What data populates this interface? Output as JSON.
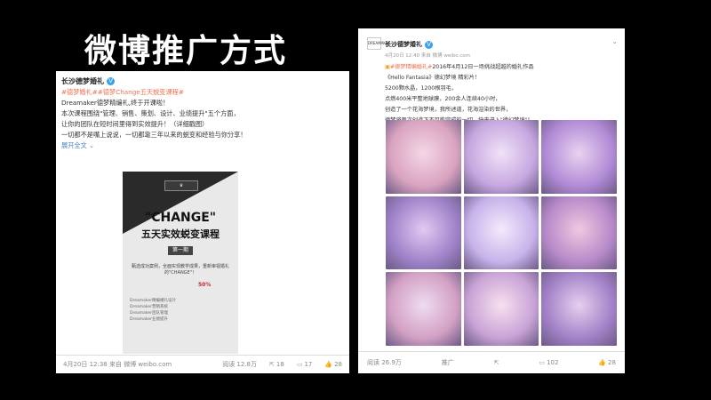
{
  "slide": {
    "title": "微博推广方式"
  },
  "post1": {
    "username": "长沙德梦婚礼",
    "tags_line": "#德梦婚礼##德梦Change五天蜕变课程#",
    "line2": "Dreamaker德梦精编礼,终于开课啦！",
    "body": [
      "本次课程围绕\"管理、销售、策划、设计、业绩提升\"五个方面，",
      "让你的团队在短时间里得到实效提升！（详细戳图）",
      "一切都不是嘴上说说，一切都靠三年以来的蜕变和经验与你分享！"
    ],
    "expand": "展开全文",
    "poster": {
      "change": "\"CHANGE\"",
      "subtitle": "五天实效蜕变课程",
      "period": "第一期",
      "small": "甄选成功案例，全面实现教学成果，重新审视婚礼的\"CHANGE\"！",
      "percent": "50%",
      "list": [
        "Dreamaker精编婚礼设计",
        "Dreamaker营销系统",
        "Dreamaker团队管理",
        "Dreamaker业绩提升"
      ]
    },
    "footer": {
      "source": "4月20日 12:38 来自 微博 weibo.com",
      "read": "阅读 12.8万",
      "forward": "18",
      "comment": "17",
      "like": "28"
    }
  },
  "post2": {
    "avatar_text": "DREAMAKER",
    "username": "长沙德梦婚礼",
    "meta": "4月20日 12:40 来自 微博 weibo.com",
    "line1_tag": "#德梦精编婚礼#",
    "line1_rest": "2016年4月12日一场挑战超越的婚礼作品",
    "line2": "《Hello Fantasia》德幻梦境 精彩片！",
    "line3": "5200颗水晶，1200根羽毛，",
    "line4": "点燃400米平整地球膜，200余人连续40小时，",
    "line5": "创造了一个花海梦境，我所述道，花海渲染的世界，",
    "line6": "德梦将再次创造下不可能完成的一切，快来进入\"德幻梦境\"！",
    "photos": [
      {
        "c1": "#d9a3c0",
        "c2": "#f5d7e6"
      },
      {
        "c1": "#c6a7e0",
        "c2": "#f0e3f7"
      },
      {
        "c1": "#b18bd6",
        "c2": "#e9d2f0"
      },
      {
        "c1": "#9f83c9",
        "c2": "#e2c9f2"
      },
      {
        "c1": "#c7b2ea",
        "c2": "#f4eafc"
      },
      {
        "c1": "#b78ac9",
        "c2": "#f0c8e0"
      },
      {
        "c1": "#d3a0c4",
        "c2": "#eedcf0"
      },
      {
        "c1": "#c8a3d6",
        "c2": "#f7e1ef"
      },
      {
        "c1": "#a382c8",
        "c2": "#e6cfee"
      }
    ],
    "footer": {
      "read": "阅读 26.9万",
      "forward_label": "推广",
      "comment": "102",
      "like": "28"
    }
  }
}
